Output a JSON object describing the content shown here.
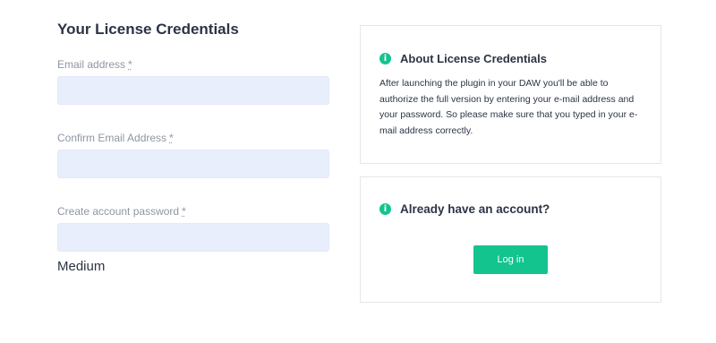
{
  "form": {
    "title": "Your License Credentials",
    "required_marker": "*",
    "fields": [
      {
        "label": "Email address",
        "value": "",
        "placeholder": ""
      },
      {
        "label": "Confirm Email Address",
        "value": "",
        "placeholder": ""
      },
      {
        "label": "Create account password",
        "value": "",
        "placeholder": ""
      }
    ],
    "password_strength": "Medium"
  },
  "about_card": {
    "icon": "info-icon",
    "icon_glyph": "i",
    "title": "About License Credentials",
    "body": "After launching the plugin in your DAW you'll be able to authorize the full version by entering your e-mail address and your password. So please make sure that you typed in your e-mail address correctly."
  },
  "login_card": {
    "icon": "info-icon",
    "icon_glyph": "i",
    "title": "Already have an account?",
    "button_label": "Log in"
  },
  "colors": {
    "accent": "#13c48f",
    "input_bg": "#e8eefc",
    "text": "#2b3445",
    "label": "#8e96a3"
  }
}
